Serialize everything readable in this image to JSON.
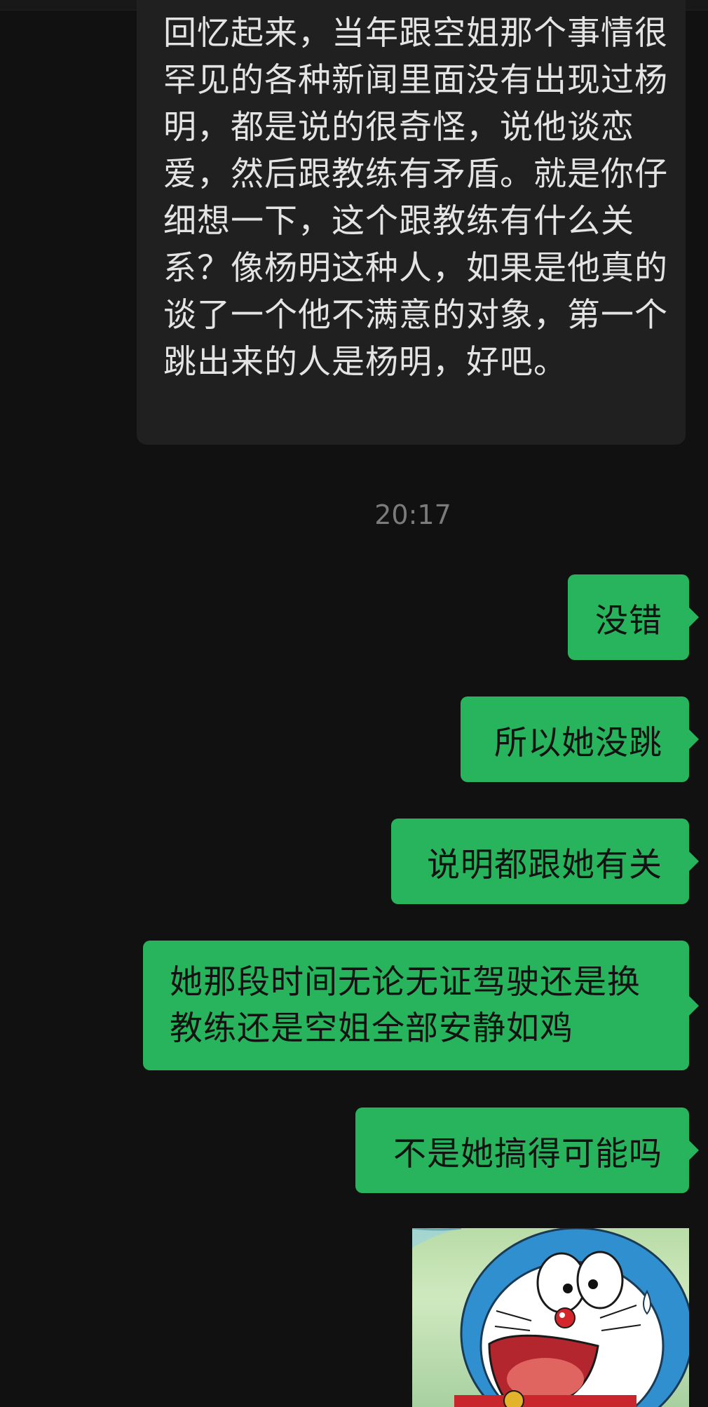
{
  "chat": {
    "incoming_text": "回忆起来，当年跟空姐那个事情很罕见的各种新闻里面没有出现过杨明，都是说的很奇怪，说他谈恋爱，然后跟教练有矛盾。就是你仔细想一下，这个跟教练有什么关系？像杨明这种人，如果是他真的谈了一个他不满意的对象，第一个跳出来的人是杨明，好吧。",
    "timestamp": "20:17",
    "outgoing": [
      "没错",
      "所以她没跳",
      "说明都跟她有关",
      "她那段时间无论无证驾驶还是换教练还是空姐全部安静如鸡",
      "不是她搞得可能吗"
    ],
    "sticker": "doraemon-shocked-sticker"
  },
  "colors": {
    "background": "#111111",
    "incoming_bubble": "#202020",
    "outgoing_bubble": "#27b45c",
    "timestamp": "#7b7b7b"
  }
}
